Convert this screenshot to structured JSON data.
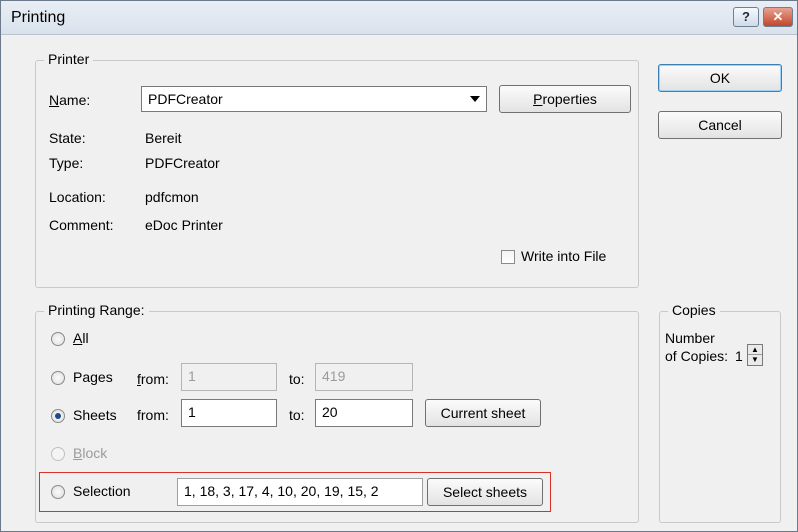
{
  "window": {
    "title": "Printing",
    "help_glyph": "?",
    "close_glyph": "✕"
  },
  "printer": {
    "legend": "Printer",
    "name_label": "Name:",
    "name_value": "PDFCreator",
    "properties_label": "Properties",
    "state_label": "State:",
    "state_value": "Bereit",
    "type_label": "Type:",
    "type_value": "PDFCreator",
    "location_label": "Location:",
    "location_value": "pdfcmon",
    "comment_label": "Comment:",
    "comment_value": "eDoc Printer",
    "write_file_label": "Write into File"
  },
  "buttons": {
    "ok": "OK",
    "cancel": "Cancel"
  },
  "range": {
    "legend": "Printing Range:",
    "all": "All",
    "pages": "Pages",
    "sheets": "Sheets",
    "block": "Block",
    "selection": "Selection",
    "from": "from:",
    "to": "to:",
    "pages_from": "1",
    "pages_to": "419",
    "sheets_from": "1",
    "sheets_to": "20",
    "current_sheet": "Current sheet",
    "selection_value": "1, 18, 3, 17, 4, 10, 20, 19, 15, 2",
    "select_sheets": "Select sheets"
  },
  "copies": {
    "legend": "Copies",
    "label_line1": "Number",
    "label_line2": "of Copies:",
    "value": "1"
  }
}
